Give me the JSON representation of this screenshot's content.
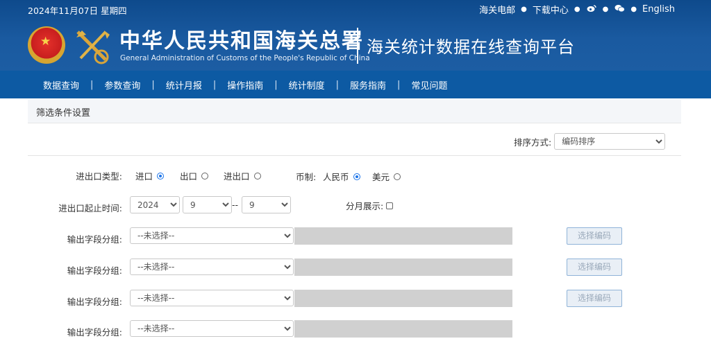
{
  "header": {
    "date": "2024年11月07日 星期四",
    "links": {
      "mail": "海关电邮",
      "download": "下载中心",
      "weibo_icon": "weibo-icon",
      "wechat_icon": "wechat-icon",
      "english": "English"
    },
    "title_cn": "中华人民共和国海关总署",
    "title_en": "General Administration of Customs of the People's Republic of China",
    "subtitle": "海关统计数据在线查询平台"
  },
  "nav": [
    "数据查询",
    "参数查询",
    "统计月报",
    "操作指南",
    "统计制度",
    "服务指南",
    "常见问题"
  ],
  "panel": {
    "title": "筛选条件设置"
  },
  "sort": {
    "label": "排序方式:",
    "value": "编码排序"
  },
  "trade_type": {
    "label": "进出口类型:",
    "options": [
      {
        "label": "进口",
        "selected": true
      },
      {
        "label": "出口",
        "selected": false
      },
      {
        "label": "进出口",
        "selected": false
      }
    ]
  },
  "currency": {
    "label": "币制:",
    "options": [
      {
        "label": "人民币",
        "selected": true
      },
      {
        "label": "美元",
        "selected": false
      }
    ]
  },
  "period": {
    "label": "进出口起止时间:",
    "year": "2024",
    "start_month": "9",
    "separator": "--",
    "end_month": "9",
    "monthly_label": "分月展示:",
    "monthly_checked": false
  },
  "field_groups": [
    {
      "label": "输出字段分组:",
      "value": "--未选择--",
      "button": "选择编码"
    },
    {
      "label": "输出字段分组:",
      "value": "--未选择--",
      "button": "选择编码"
    },
    {
      "label": "输出字段分组:",
      "value": "--未选择--",
      "button": "选择编码"
    },
    {
      "label": "输出字段分组:",
      "value": "--未选择--"
    }
  ],
  "colors": {
    "header_blue": "#0e4a8c",
    "nav_blue": "#0d5aa3",
    "radio_blue": "#1a73e8"
  }
}
